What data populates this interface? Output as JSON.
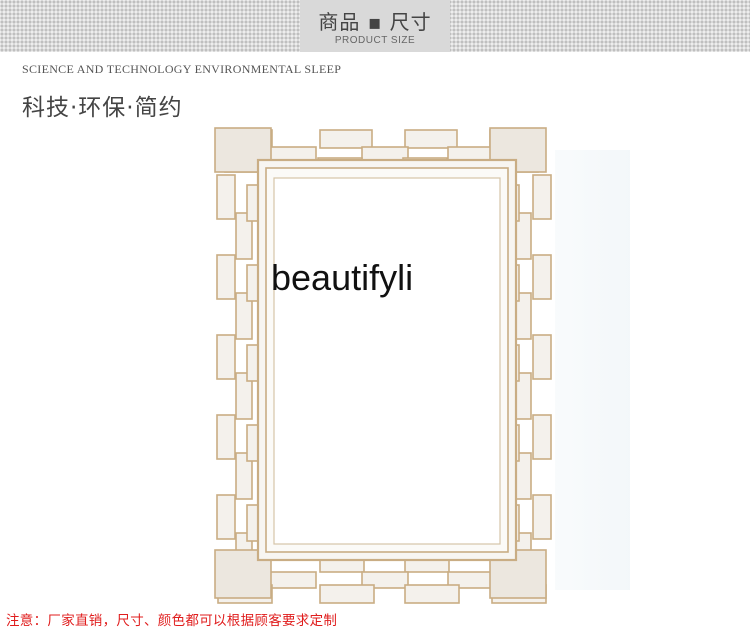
{
  "header": {
    "title": "商品 ▪ 尺寸",
    "subtitle": "PRODUCT SIZE"
  },
  "tagline": {
    "english": "SCIENCE AND TECHNOLOGY ENVIRONMENTAL SLEEP",
    "chinese": "科技·环保·简约"
  },
  "watermark": "beautifyli",
  "note": "注意：厂家直销，尺寸、颜色都可以根据顾客要求定制",
  "colors": {
    "frame_gold": "#c9ad84",
    "frame_fill": "#f4f1ec",
    "note_red": "#e01d1d"
  }
}
